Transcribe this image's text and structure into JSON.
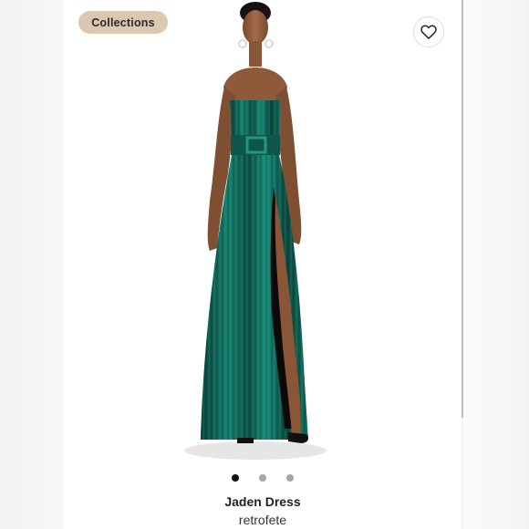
{
  "collections_label": "Collections",
  "favorite_icon": "heart-outline-icon",
  "product": {
    "name": "Jaden Dress",
    "brand": "retrofete",
    "image_description": "Model wearing a strapless emerald green metallic pleated maxi dress with belt and high slit"
  },
  "carousel": {
    "total": 3,
    "active_index": 0
  },
  "colors": {
    "pill": "#dcc7b0",
    "dress": "#0f5a4e",
    "active_dot": "#111111",
    "inactive_dot": "#a6a6a6"
  }
}
